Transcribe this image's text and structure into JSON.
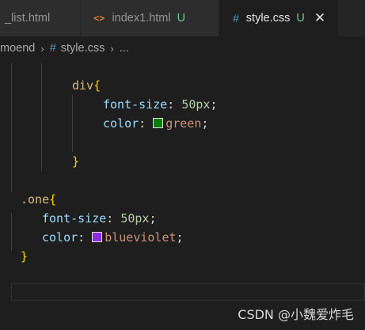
{
  "tabs": [
    {
      "label": "_list.html",
      "state": "inactive"
    },
    {
      "icon": "<>",
      "label": "index1.html",
      "badge": "U",
      "state": "inactive"
    },
    {
      "icon": "#",
      "label": "style.css",
      "badge": "U",
      "state": "active",
      "close": "✕"
    }
  ],
  "breadcrumb": {
    "folder": "moend",
    "sep": "›",
    "file_icon": "#",
    "file": "style.css",
    "more": "..."
  },
  "code": {
    "l1_sel": "div",
    "l1_open": "{",
    "l2_prop": "font-size",
    "l2_colon": ":",
    "l2_value": "50px",
    "l2_semi": ";",
    "l3_prop": "color",
    "l3_colon": ":",
    "l3_value": "green",
    "l3_semi": ";",
    "l3_swatch": "#008000",
    "l5_close": "}",
    "l7_sel": ".one",
    "l7_open": "{",
    "l8_prop": "font-size",
    "l8_colon": ":",
    "l8_value": "50px",
    "l8_semi": ";",
    "l9_prop": "color",
    "l9_colon": ":",
    "l9_value": "blueviolet",
    "l9_semi": ";",
    "l9_swatch": "#8a2be2",
    "l10_close": "}"
  },
  "watermark": "CSDN @小魏爱炸毛"
}
